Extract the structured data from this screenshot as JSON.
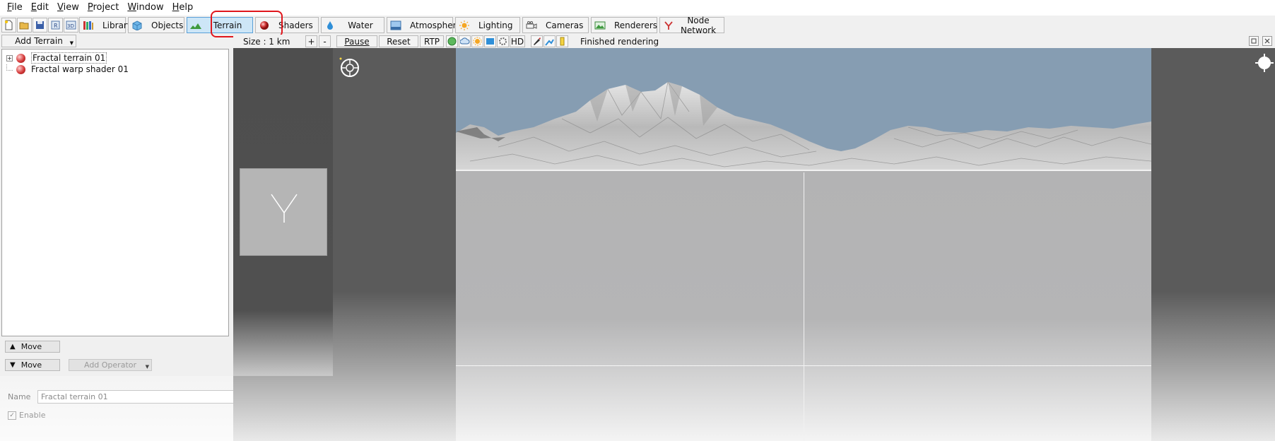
{
  "menu": [
    {
      "label": "File",
      "key": "F",
      "rest": "ile"
    },
    {
      "label": "Edit",
      "key": "E",
      "rest": "dit"
    },
    {
      "label": "View",
      "key": "V",
      "rest": "iew"
    },
    {
      "label": "Project",
      "key": "P",
      "rest": "roject"
    },
    {
      "label": "Window",
      "key": "W",
      "rest": "indow"
    },
    {
      "label": "Help",
      "key": "H",
      "rest": "elp"
    }
  ],
  "toolbar": {
    "library": "Library",
    "objects": "Objects",
    "terrain": "Terrain",
    "shaders": "Shaders",
    "water": "Water",
    "atmosphere": "Atmosphere",
    "lighting": "Lighting",
    "cameras": "Cameras",
    "renderers": "Renderers",
    "node_network": "Node Network",
    "active_tab": "Terrain"
  },
  "left_panel": {
    "add_terrain": "Add Terrain",
    "tree": [
      {
        "label": "Fractal terrain 01",
        "expander": "+",
        "selected": true
      },
      {
        "label": "Fractal warp shader 01",
        "selected": false
      }
    ],
    "move_up": "Move",
    "move_down": "Move",
    "add_operator": "Add Operator"
  },
  "properties": {
    "name_label": "Name",
    "name_value": "Fractal terrain 01",
    "help": "?",
    "enable_label": "Enable",
    "enable_glyph": "✓"
  },
  "viewport_toolbar": {
    "size": "Size : 1 km",
    "plus": "+",
    "minus": "-",
    "pause": "Pause",
    "reset": "Reset",
    "rtp": "RTP",
    "hd": "HD",
    "status": "Finished rendering"
  },
  "colors": {
    "sky": "#869db2",
    "active_tab_bg": "#cde6f7",
    "highlight": "#e0161c"
  }
}
